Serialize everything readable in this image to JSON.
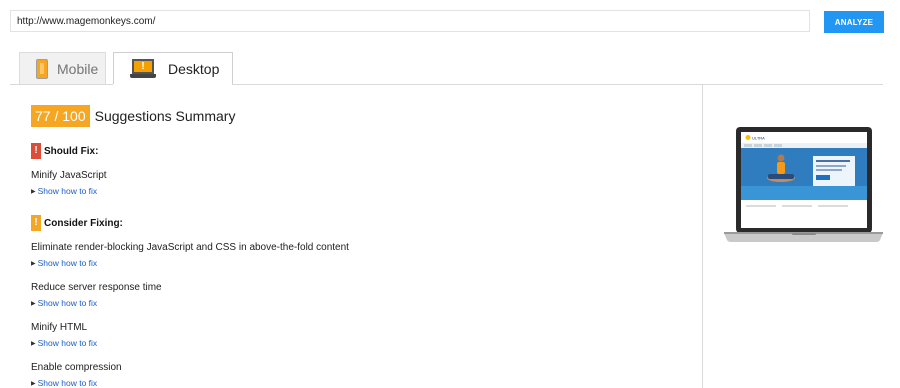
{
  "url_input": {
    "value": "http://www.magemonkeys.com/"
  },
  "analyze_button": {
    "label": "ANALYZE"
  },
  "tabs": [
    {
      "label": "Mobile",
      "active": false
    },
    {
      "label": "Desktop",
      "active": true
    }
  ],
  "summary": {
    "score": "77 / 100",
    "title": "Suggestions Summary"
  },
  "should_fix": {
    "heading": "Should Fix:",
    "icon_glyph": "!",
    "items": [
      {
        "title": "Minify JavaScript",
        "link": "Show how to fix"
      }
    ]
  },
  "consider_fixing": {
    "heading": "Consider Fixing:",
    "icon_glyph": "!",
    "items": [
      {
        "title": "Eliminate render-blocking JavaScript and CSS in above-the-fold content",
        "link": "Show how to fix"
      },
      {
        "title": "Reduce server response time",
        "link": "Show how to fix"
      },
      {
        "title": "Minify HTML",
        "link": "Show how to fix"
      },
      {
        "title": "Enable compression",
        "link": "Show how to fix"
      }
    ]
  },
  "preview": {
    "brand": "ULTRA"
  },
  "colors": {
    "accent_blue": "#2196f3",
    "score_orange": "#f5a623",
    "should_fix_red": "#dd4b39",
    "link_blue": "#1a5fc7"
  }
}
